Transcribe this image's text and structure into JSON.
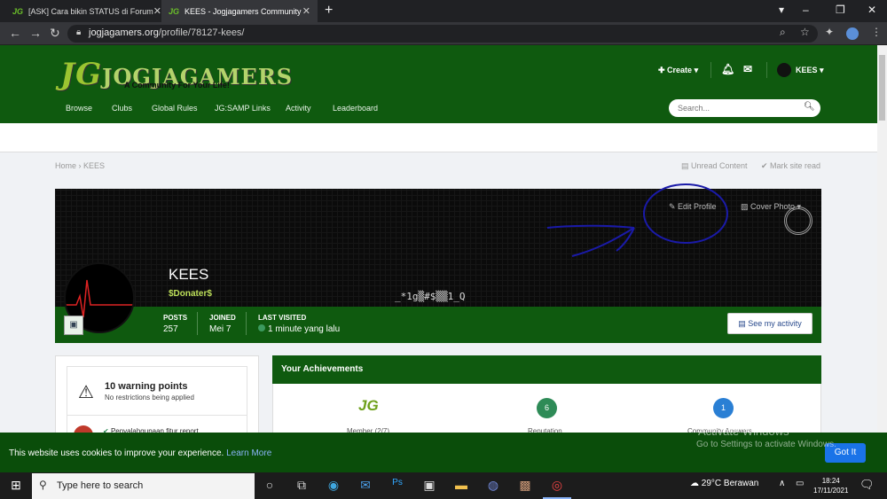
{
  "browser": {
    "tabs": [
      {
        "favicon": "JG",
        "label": "[ASK] Cara bikin STATUS di Forum"
      },
      {
        "favicon": "JG",
        "label": "KEES - Jogjagamers Community"
      }
    ],
    "new_tab": "+",
    "url_host": "jogjagamers.org",
    "url_path": "/profile/78127-kees/",
    "icons": [
      "back-icon",
      "forward-icon",
      "reload-icon",
      "lock-icon",
      "zoom-icon",
      "star-icon",
      "extensions-icon",
      "profile-icon",
      "menu-icon"
    ]
  },
  "site": {
    "logo": "JOGJAGAMERS",
    "logo_mark": "JG",
    "tagline": "A Community For Your Life!",
    "nav": [
      "Browse",
      "Clubs",
      "Global Rules",
      "JG:SAMP Links",
      "Activity",
      "Leaderboard"
    ],
    "create_label": "Create",
    "user_label": "KEES",
    "search_placeholder": "Search...",
    "breadcrumb": {
      "home": "Home",
      "sep": "›",
      "current": "KEES"
    },
    "unread": "Unread Content",
    "mark_read": "Mark site read"
  },
  "profile": {
    "edit": "Edit Profile",
    "cover_photo": "Cover Photo",
    "name": "KEES",
    "group": "$Donater$",
    "cover_text": "_*1g▒#$▒▒1_Q",
    "stats": [
      {
        "label": "POSTS",
        "value": "257"
      },
      {
        "label": "JOINED",
        "value": "Mei 7"
      },
      {
        "label": "LAST VISITED",
        "value": "1 minute yang lalu"
      }
    ],
    "see_activity": "See my activity"
  },
  "warning": {
    "title": "10 warning points",
    "sub": "No restrictions being applied",
    "item": "Penyalahgunaan fitur report"
  },
  "achievements": {
    "title": "Your Achievements",
    "rank_icon": "JG",
    "items": [
      {
        "value": "",
        "label": "Member (2/7)"
      },
      {
        "value": "6",
        "label": "Reputation"
      },
      {
        "value": "1",
        "label": "Community Answers"
      }
    ],
    "colors": {
      "reputation": "#2e8b57",
      "answers": "#2a7fd4"
    }
  },
  "cookie": {
    "text": "This website uses cookies to improve your experience.",
    "link": "Learn More",
    "button": "Got It"
  },
  "watermark": {
    "line1": "Activate Windows",
    "line2": "Go to Settings to activate Windows."
  },
  "taskbar": {
    "search": "Type here to search",
    "weather": "29°C  Berawan",
    "time": "18:24",
    "date": "17/11/2021"
  },
  "colors": {
    "brand_green": "#0f5a0f",
    "accent_lime": "#9bc531"
  }
}
